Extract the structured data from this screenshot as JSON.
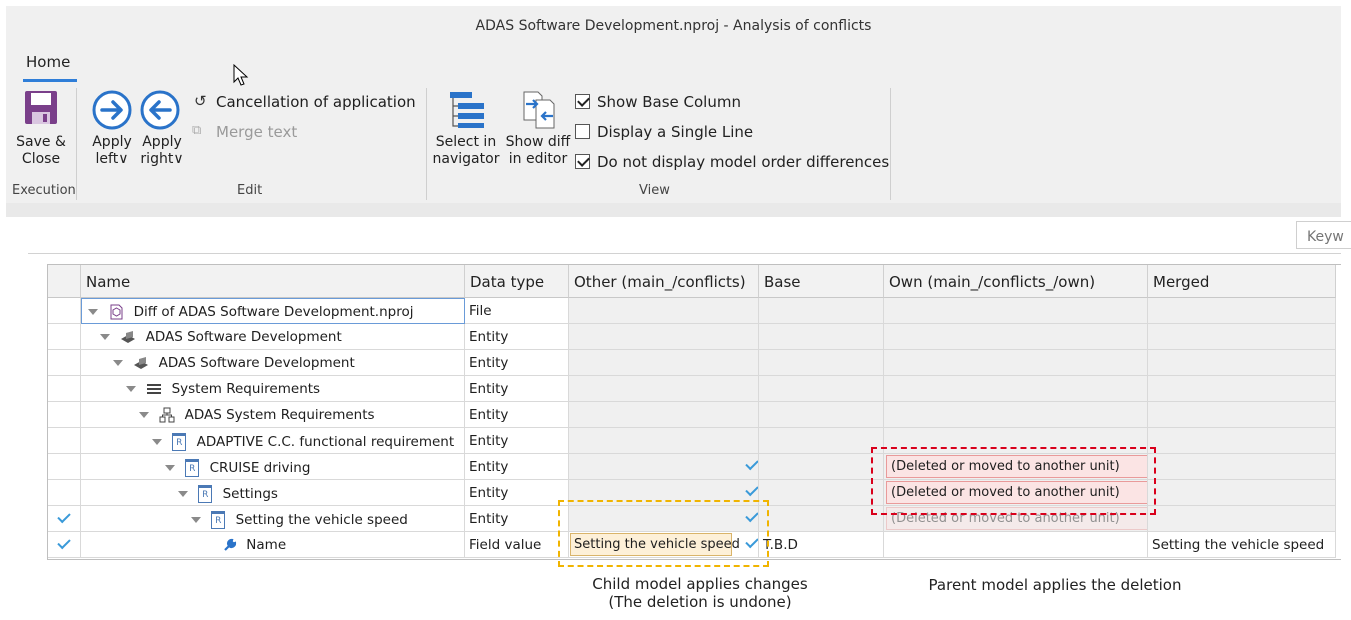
{
  "window": {
    "title": "ADAS Software Development.nproj - Analysis of conflicts"
  },
  "ribbon": {
    "tab": "Home",
    "groups": {
      "execution": "Execution",
      "edit": "Edit",
      "view": "View"
    },
    "buttons": {
      "save_close_line1": "Save &",
      "save_close_line2": "Close",
      "apply_left_line1": "Apply",
      "apply_left_line2": "left∨",
      "apply_right_line1": "Apply",
      "apply_right_line2": "right∨",
      "cancellation": "Cancellation of application",
      "merge_text": "Merge text",
      "select_nav_line1": "Select in",
      "select_nav_line2": "navigator",
      "show_diff_line1": "Show diff",
      "show_diff_line2": "in editor"
    },
    "checkboxes": [
      {
        "label": "Show Base Column",
        "checked": true
      },
      {
        "label": "Display a Single Line",
        "checked": false
      },
      {
        "label": "Do not display model order differences",
        "checked": true
      }
    ]
  },
  "search": {
    "placeholder": "Keyw"
  },
  "grid": {
    "columns": [
      "Name",
      "Data type",
      "Other (main_/conflicts)",
      "Base",
      "Own (main_/conflicts_/own)",
      "Merged"
    ],
    "rows": [
      {
        "name": "Diff of ADAS Software Development.nproj",
        "type": "File",
        "icon": "project-icon"
      },
      {
        "name": "ADAS Software Development",
        "type": "Entity",
        "icon": "entity-icon"
      },
      {
        "name": "ADAS Software Development",
        "type": "Entity",
        "icon": "entity-icon"
      },
      {
        "name": "System Requirements",
        "type": "Entity",
        "icon": "list-icon"
      },
      {
        "name": "ADAS System Requirements",
        "type": "Entity",
        "icon": "tree-icon"
      },
      {
        "name": "ADAPTIVE C.C. functional requirement",
        "type": "Entity",
        "icon": "requirement-icon"
      },
      {
        "name": "CRUISE driving",
        "type": "Entity",
        "icon": "requirement-icon",
        "own": "(Deleted or moved to another unit)"
      },
      {
        "name": "Settings",
        "type": "Entity",
        "icon": "requirement-icon",
        "own": "(Deleted or moved to another unit)"
      },
      {
        "name": "Setting the vehicle speed",
        "type": "Entity",
        "icon": "requirement-icon",
        "own": "(Deleted or moved to another unit)"
      },
      {
        "name": "Name",
        "type": "Field value",
        "icon": "wrench-icon",
        "other": "Setting the vehicle speed",
        "base": "T.B.D",
        "merged": "Setting the vehicle speed"
      }
    ]
  },
  "annotations": {
    "child_line1": "Child model applies changes",
    "child_line2": "(The deletion is undone)",
    "parent": "Parent model applies the deletion"
  },
  "colors": {
    "accent": "#2f7ed8",
    "check_blue": "#3a9ad9",
    "deleted_pink": "#fbe4e4",
    "child_box": "#f0b400",
    "parent_box": "#d9001b"
  }
}
